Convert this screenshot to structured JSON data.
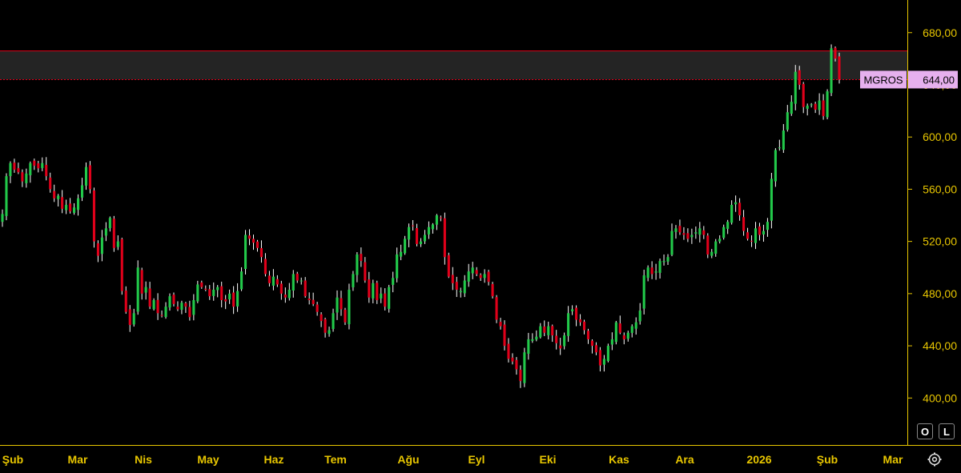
{
  "chart_data": {
    "type": "candlestick",
    "symbol": "MGROS",
    "last_price_label": "644,00",
    "y_ticks": [
      "400,00",
      "440,00",
      "480,00",
      "520,00",
      "560,00",
      "600,00",
      "640,00",
      "680,00"
    ],
    "x_ticks": [
      "Şub",
      "Mar",
      "Nis",
      "May",
      "Haz",
      "Tem",
      "Ağu",
      "Eyl",
      "Eki",
      "Kas",
      "Ara",
      "2026",
      "Şub",
      "Mar"
    ],
    "ylim": [
      364,
      705
    ],
    "zone": {
      "from": 644,
      "to": 666
    },
    "colors": {
      "up": "#22c94a",
      "down": "#e0001a",
      "wick": "#ffffff",
      "axis": "#e8c600",
      "zone_fill": "#242424",
      "zone_line": "#e0001a",
      "tag_bg": "#e6b0ee"
    },
    "closes": [
      541,
      570,
      580,
      575,
      573,
      566,
      572,
      580,
      578,
      576,
      580,
      570,
      560,
      553,
      555,
      545,
      548,
      543,
      546,
      553,
      563,
      577,
      560,
      520,
      509,
      523,
      530,
      538,
      515,
      520,
      482,
      466,
      456,
      465,
      500,
      480,
      485,
      470,
      475,
      465,
      463,
      470,
      478,
      472,
      468,
      473,
      470,
      462,
      475,
      487,
      485,
      483,
      478,
      483,
      485,
      475,
      474,
      480,
      470,
      482,
      497,
      525,
      522,
      519,
      515,
      508,
      495,
      488,
      493,
      487,
      480,
      477,
      483,
      495,
      490,
      490,
      478,
      475,
      472,
      466,
      459,
      450,
      452,
      465,
      477,
      468,
      458,
      483,
      495,
      510,
      505,
      490,
      477,
      488,
      475,
      480,
      470,
      485,
      492,
      510,
      512,
      522,
      531,
      532,
      518,
      520,
      525,
      531,
      533,
      540,
      538,
      508,
      493,
      488,
      483,
      482,
      490,
      497,
      500,
      495,
      492,
      495,
      489,
      478,
      460,
      455,
      440,
      430,
      428,
      422,
      413,
      435,
      445,
      445,
      447,
      455,
      450,
      455,
      448,
      442,
      438,
      448,
      465,
      468,
      460,
      458,
      452,
      445,
      440,
      435,
      425,
      430,
      440,
      445,
      458,
      450,
      445,
      450,
      455,
      458,
      467,
      494,
      500,
      495,
      497,
      505,
      505,
      508,
      528,
      530,
      527,
      525,
      522,
      525,
      527,
      530,
      525,
      510,
      512,
      520,
      522,
      531,
      535,
      548,
      550,
      540,
      528,
      522,
      520,
      530,
      525,
      528,
      535,
      568,
      590,
      592,
      605,
      619,
      627,
      650,
      640,
      623,
      624,
      625,
      621,
      628,
      616,
      635,
      668,
      660,
      644
    ]
  }
}
